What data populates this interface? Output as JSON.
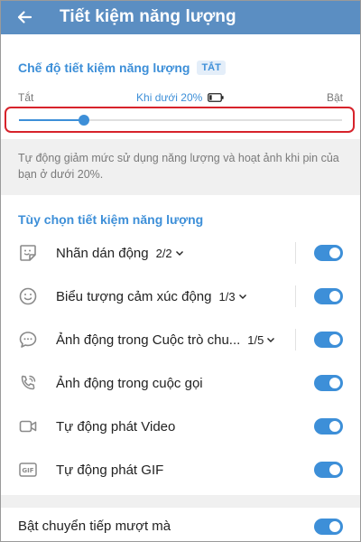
{
  "header": {
    "title": "Tiết kiệm năng lượng",
    "back_icon": "arrow-left-icon"
  },
  "mode": {
    "title": "Chế độ tiết kiệm năng lượng",
    "badge": "TẮT"
  },
  "slider": {
    "left_label": "Tắt",
    "center_label": "Khi dưới 20%",
    "right_label": "Bật",
    "value_percent": 20
  },
  "description": "Tự động giảm mức sử dụng năng lượng và hoạt ảnh khi pin của bạn ở dưới 20%.",
  "options": {
    "title": "Tùy chọn tiết kiệm năng lượng",
    "items": [
      {
        "icon": "sticker-icon",
        "label": "Nhãn dán động",
        "count": "2/2",
        "enabled": true
      },
      {
        "icon": "smiley-icon",
        "label": "Biểu tượng cảm xúc động",
        "count": "1/3",
        "enabled": true
      },
      {
        "icon": "chat-bubble-icon",
        "label": "Ảnh động trong Cuộc trò chu...",
        "count": "1/5",
        "enabled": true
      },
      {
        "icon": "phone-call-icon",
        "label": "Ảnh động trong cuộc gọi",
        "count": "",
        "enabled": true
      },
      {
        "icon": "video-camera-icon",
        "label": "Tự động phát Video",
        "count": "",
        "enabled": true
      },
      {
        "icon": "gif-icon",
        "label": "Tự động phát GIF",
        "count": "",
        "enabled": true
      }
    ]
  },
  "smooth_transitions": {
    "label": "Bật chuyển tiếp mượt mà",
    "enabled": true
  },
  "colors": {
    "header": "#5b8ec2",
    "accent": "#3d8fd8",
    "highlight": "#d7232b"
  }
}
